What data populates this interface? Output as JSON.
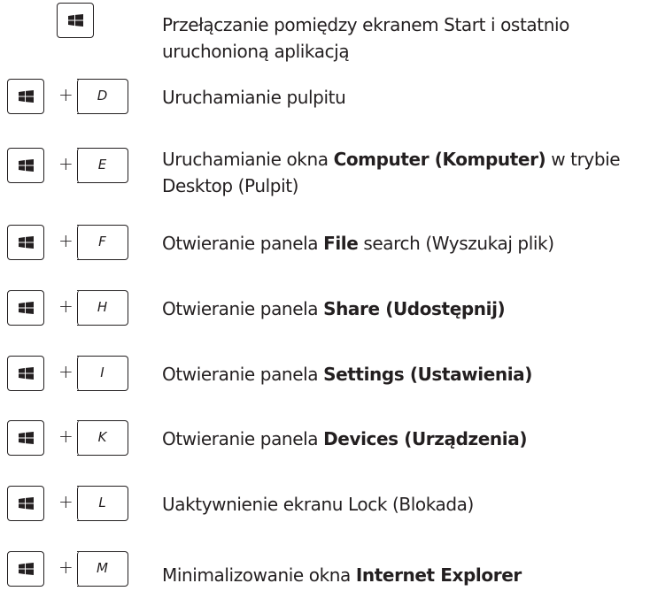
{
  "shortcuts": [
    {
      "keys": [
        "Windows"
      ],
      "description": [
        "Przełączanie pomiędzy ekranem Start i ostatnio uruchonioną aplikacją"
      ]
    },
    {
      "keys": [
        "Windows",
        "D"
      ],
      "description": [
        "Uruchamianie pulpitu"
      ]
    },
    {
      "keys": [
        "Windows",
        "E"
      ],
      "description": [
        "Uruchamianie okna ",
        "Computer (Komputer)",
        " w trybie Desktop (Pulpit)"
      ]
    },
    {
      "keys": [
        "Windows",
        "F"
      ],
      "description": [
        "Otwieranie panela ",
        "File",
        " search (Wyszukaj plik)"
      ]
    },
    {
      "keys": [
        "Windows",
        "H"
      ],
      "description": [
        "Otwieranie panela ",
        "Share (Udostępnij)"
      ]
    },
    {
      "keys": [
        "Windows",
        "I"
      ],
      "description": [
        "Otwieranie panela ",
        "Settings (Ustawienia)"
      ]
    },
    {
      "keys": [
        "Windows",
        "K"
      ],
      "description": [
        "Otwieranie panela ",
        "Devices (Urządzenia)"
      ]
    },
    {
      "keys": [
        "Windows",
        "L"
      ],
      "description": [
        "Uaktywnienie ekranu Lock (Blokada)"
      ]
    },
    {
      "keys": [
        "Windows",
        "M"
      ],
      "description": [
        "Minimalizowanie okna ",
        "Internet Explorer"
      ]
    }
  ],
  "plus_sign": "+",
  "icon": "windows-logo-icon"
}
